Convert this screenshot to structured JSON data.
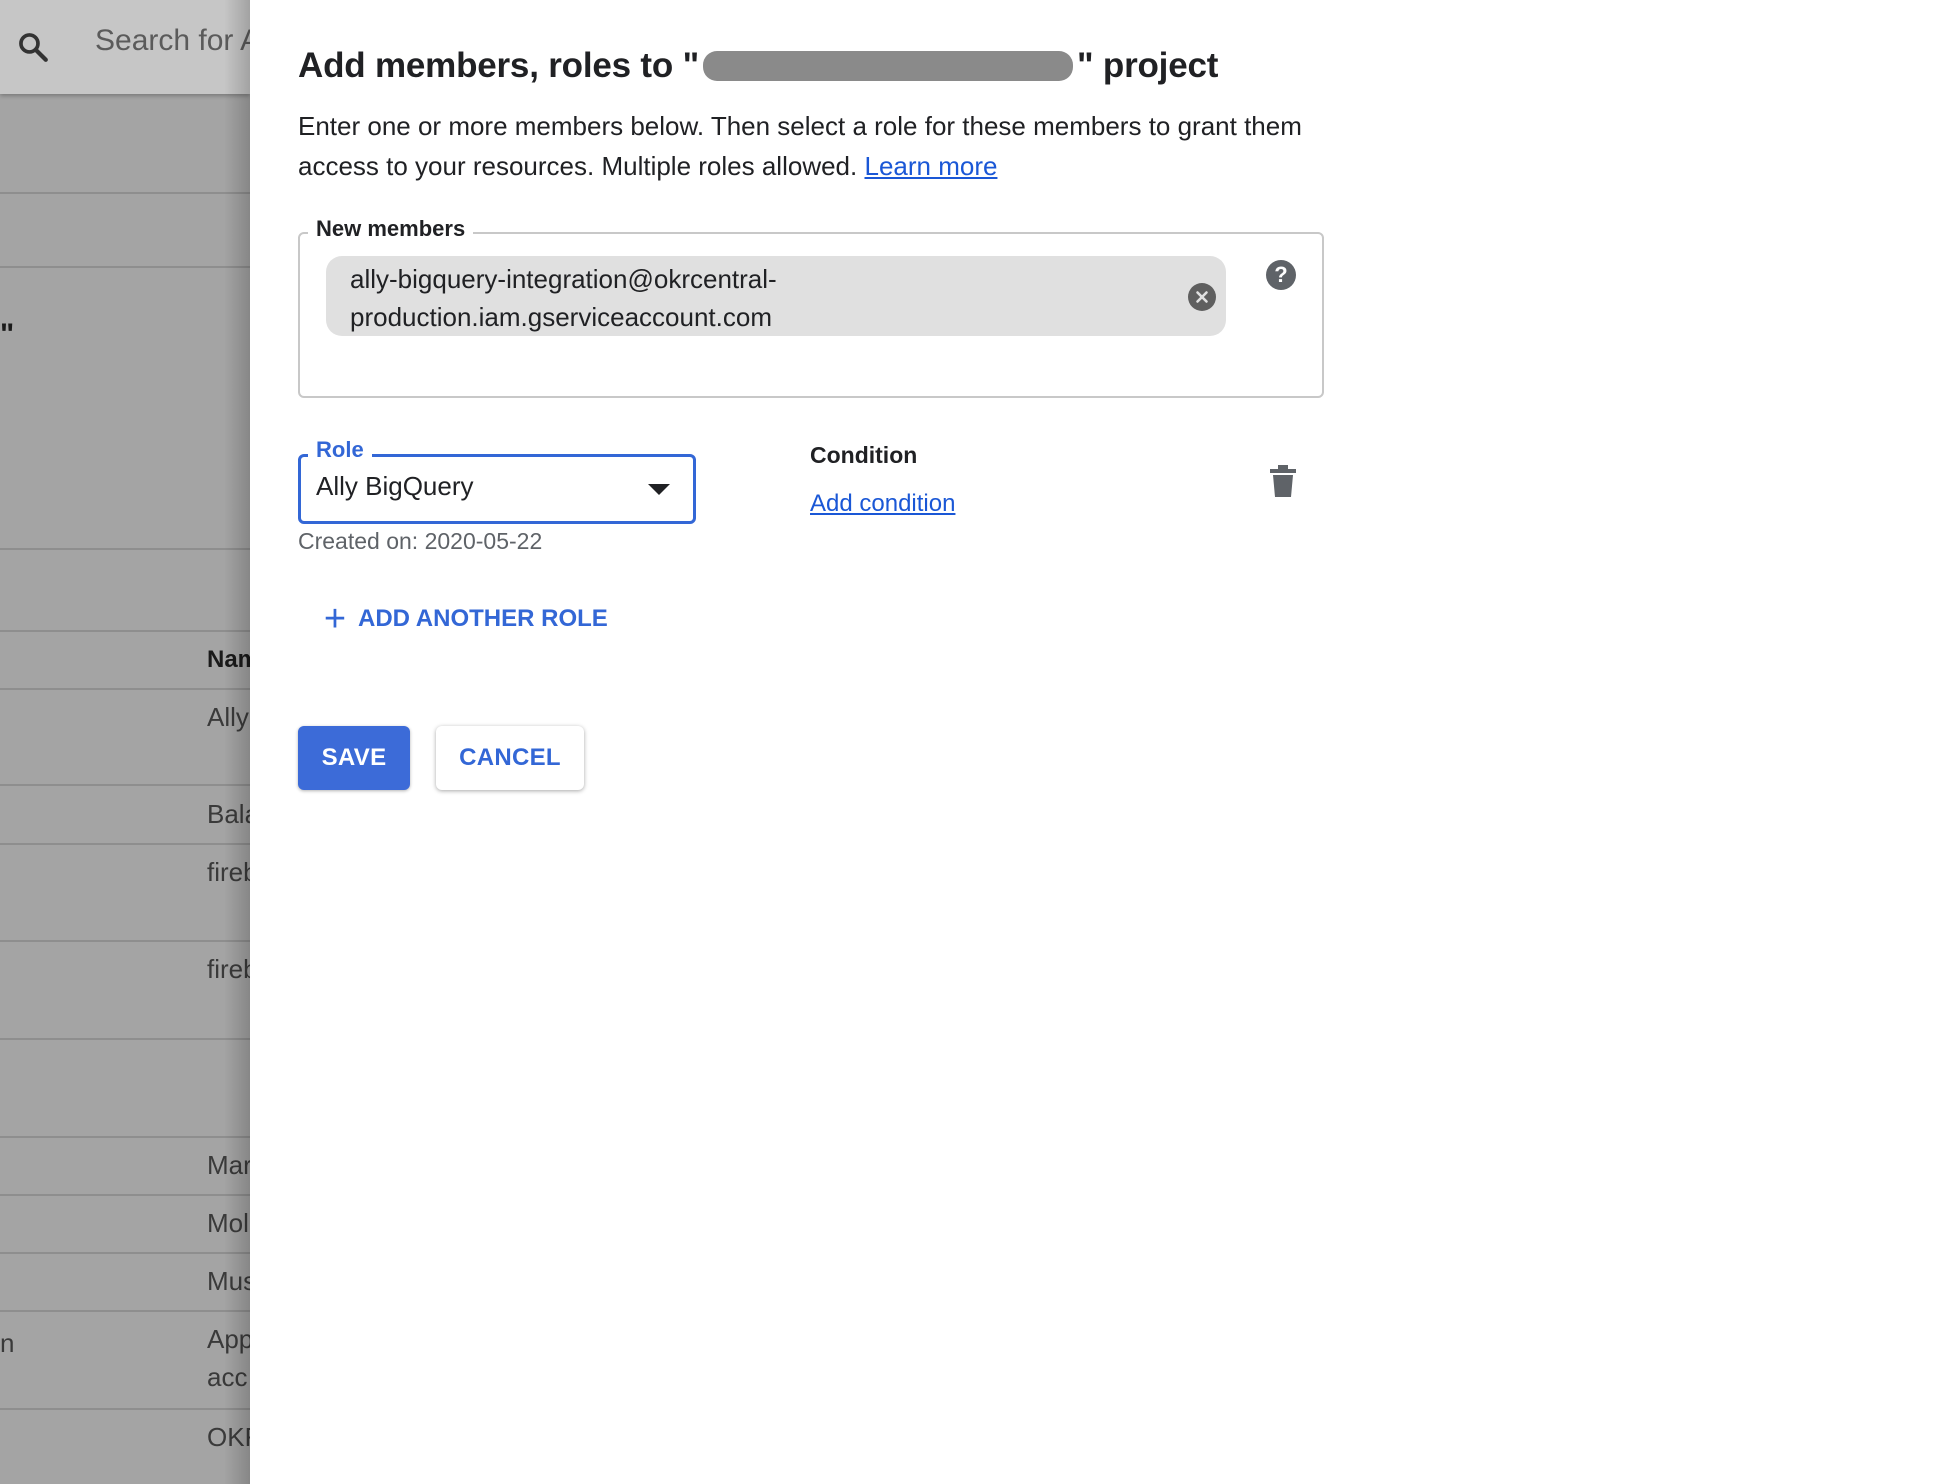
{
  "background_page": {
    "search_placeholder": "Search for A",
    "stray_quote": "\"",
    "column_header": "Nam",
    "rows": [
      "Ally",
      "Bala",
      "fireb",
      "fireb",
      "Mar",
      "Mol",
      "Mus",
      "App",
      "acc",
      "OKF"
    ],
    "left_fragment": "n"
  },
  "dialog": {
    "title_prefix": "Add members, roles to \"",
    "title_suffix": "\" project",
    "description": "Enter one or more members below. Then select a role for these members to grant them access to your resources. Multiple roles allowed.",
    "learn_more": "Learn more",
    "members": {
      "legend": "New members",
      "chip_value": "ally-bigquery-integration@okrcentral-production.iam.gserviceaccount.com",
      "chip_line1": "ally-bigquery-integration@okrcentral-",
      "chip_line2": "production.iam.gserviceaccount.com"
    },
    "role": {
      "legend": "Role",
      "value": "Ally BigQuery",
      "helper": "Created on: 2020-05-22"
    },
    "condition": {
      "label": "Condition",
      "link": "Add condition"
    },
    "add_another_role": "ADD ANOTHER ROLE",
    "buttons": {
      "save": "SAVE",
      "cancel": "CANCEL"
    }
  },
  "icons": [
    "search-icon",
    "close-circle-icon",
    "help-icon",
    "dropdown-arrow-icon",
    "trash-icon",
    "plus-icon"
  ],
  "colors": {
    "accent": "#3367d6",
    "link": "#1a57d6",
    "save_button": "#3c6bd8",
    "overlay": "#a4a4a4"
  }
}
